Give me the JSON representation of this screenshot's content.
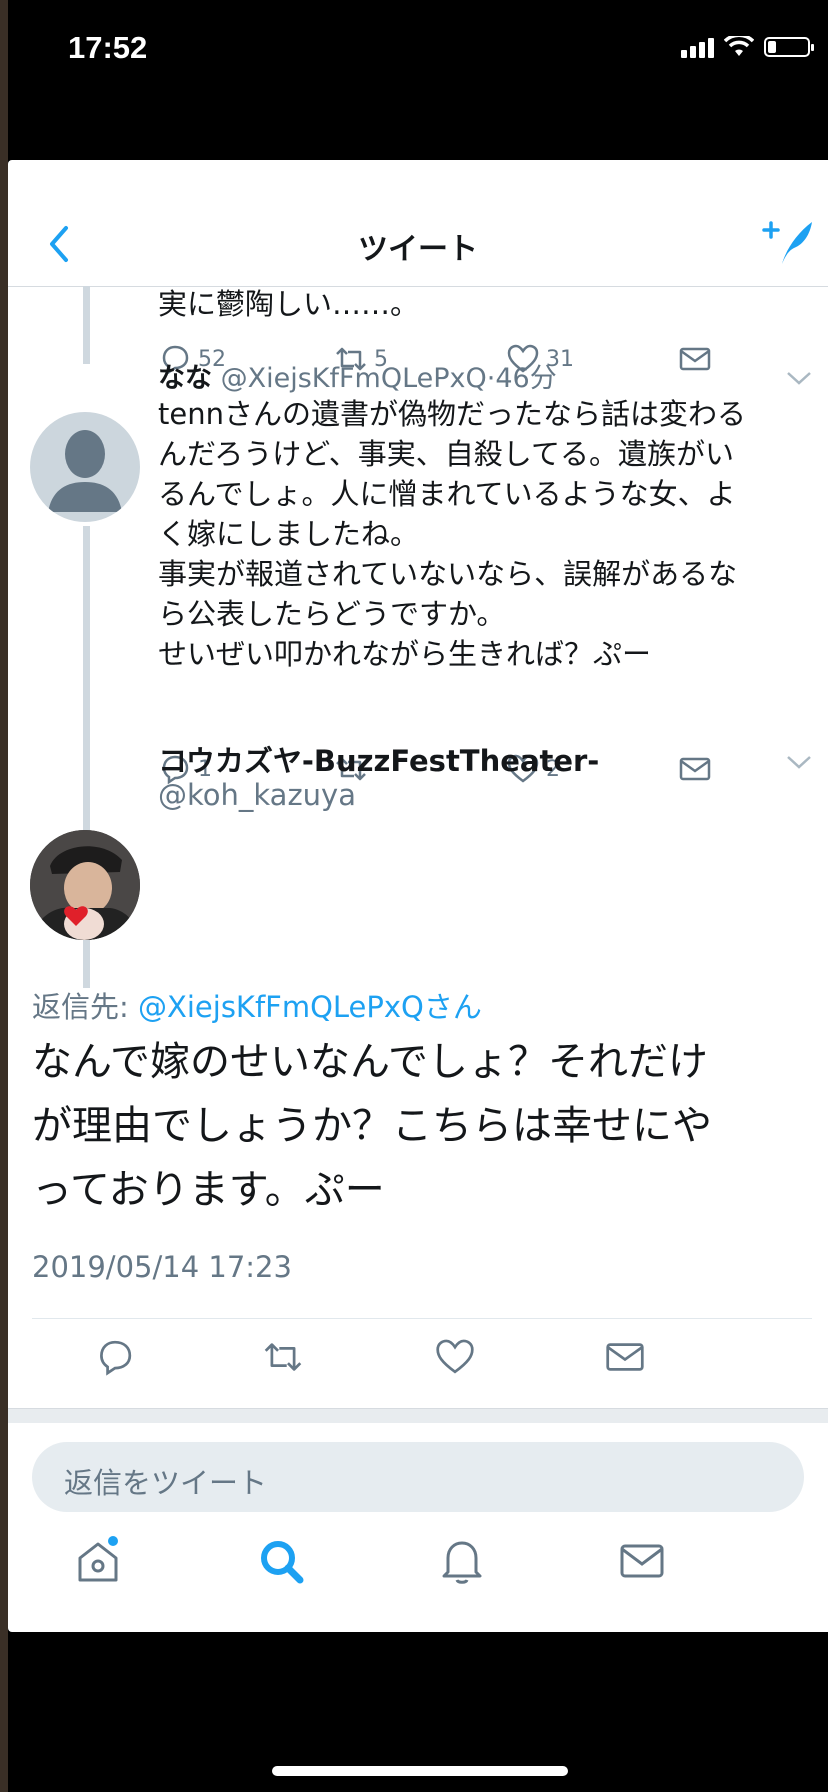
{
  "status_bar": {
    "time": "17:52"
  },
  "nav": {
    "title": "ツイート"
  },
  "tweet_prev": {
    "text_tail": "実に鬱陶しい……。",
    "reply_count": "52",
    "retweet_count": "5",
    "like_count": "31"
  },
  "tweet_nana": {
    "display_name": "なな",
    "handle": "@XiejsKfFmQLePxQ",
    "time": "·46分",
    "lines": [
      "tennさんの遺書が偽物だったなら話は変わる",
      "んだろうけど、事実、自殺してる。遺族がい",
      "るんでしょ。人に憎まれているような女、よ",
      "く嫁にしましたね。",
      "事実が報道されていないなら、誤解があるな",
      "ら公表したらどうですか。",
      "せいぜい叩かれながら生きれば？ぷー"
    ],
    "reply_count": "1",
    "retweet_count": "",
    "like_count": "2"
  },
  "main_tweet": {
    "display_name": "コウカズヤ-BuzzFestTheater-",
    "handle": "@koh_kazuya",
    "reply_label": "返信先:",
    "reply_handle": "@XiejsKfFmQLePxQさん",
    "lines": [
      "なんで嫁のせいなんでしょ？それだけ",
      "が理由でしょうか？こちらは幸せにや",
      "っております。ぷー"
    ],
    "timestamp": "2019/05/14 17:23"
  },
  "reply_box": {
    "placeholder": "返信をツイート"
  },
  "colors": {
    "accent": "#1da1f2",
    "muted": "#657786",
    "text": "#14171a"
  },
  "icons": [
    "back-chevron-icon",
    "compose-icon",
    "reply-icon",
    "retweet-icon",
    "like-icon",
    "dm-icon",
    "chevron-down-icon",
    "home-icon",
    "search-icon",
    "notifications-icon",
    "messages-icon"
  ]
}
